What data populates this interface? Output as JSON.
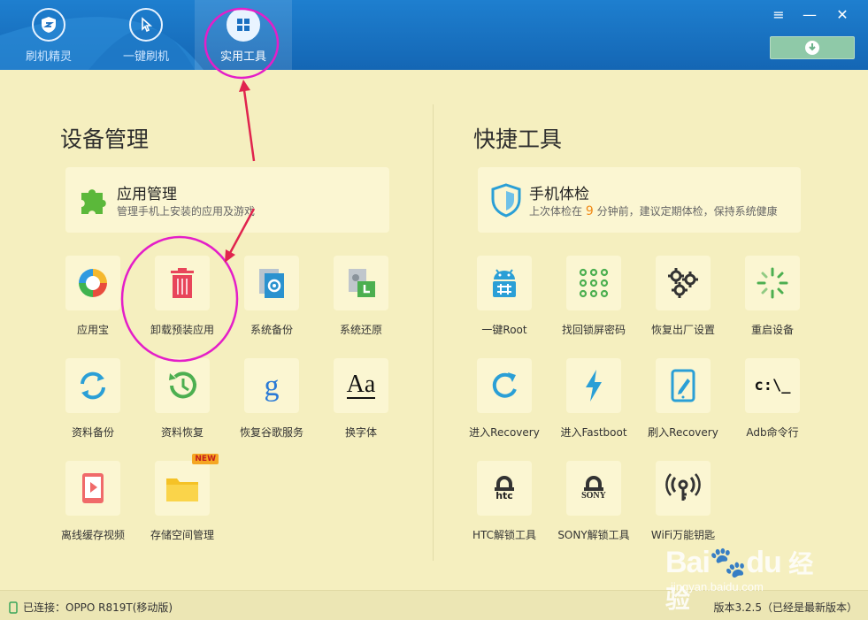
{
  "nav": {
    "tabs": [
      {
        "label": "刷机精灵",
        "icon": "shield-icon"
      },
      {
        "label": "一键刷机",
        "icon": "cursor-icon"
      },
      {
        "label": "实用工具",
        "icon": "grid-icon"
      }
    ],
    "active": 2
  },
  "window": {
    "menu": "≡",
    "minimize": "—",
    "close": "✕"
  },
  "device_mgmt": {
    "title": "设备管理",
    "card": {
      "title": "应用管理",
      "subtitle": "管理手机上安装的应用及游戏",
      "icon": "puzzle-icon"
    },
    "tools": [
      {
        "label": "应用宝",
        "icon": "app-store-icon"
      },
      {
        "label": "卸载预装应用",
        "icon": "trash-icon"
      },
      {
        "label": "系统备份",
        "icon": "system-backup-icon"
      },
      {
        "label": "系统还原",
        "icon": "system-restore-icon"
      },
      {
        "label": "资料备份",
        "icon": "sync-icon"
      },
      {
        "label": "资料恢复",
        "icon": "history-icon"
      },
      {
        "label": "恢复谷歌服务",
        "icon": "google-icon"
      },
      {
        "label": "换字体",
        "icon": "font-icon",
        "glyph": "Aa"
      },
      {
        "label": "离线缓存视频",
        "icon": "video-icon"
      },
      {
        "label": "存储空间管理",
        "icon": "folder-icon",
        "badge": "NEW"
      }
    ]
  },
  "quick_tools": {
    "title": "快捷工具",
    "card": {
      "title": "手机体检",
      "sub_prefix": "上次体检在",
      "sub_num": "9",
      "sub_suffix": "分钟前，建议定期体检，保持系统健康",
      "icon": "shield-check-icon"
    },
    "tools": [
      {
        "label": "一键Root",
        "icon": "android-icon"
      },
      {
        "label": "找回锁屏密码",
        "icon": "pattern-lock-icon"
      },
      {
        "label": "恢复出厂设置",
        "icon": "gears-icon"
      },
      {
        "label": "重启设备",
        "icon": "loading-icon"
      },
      {
        "label": "进入Recovery",
        "icon": "refresh-icon"
      },
      {
        "label": "进入Fastboot",
        "icon": "lightning-icon"
      },
      {
        "label": "刷入Recovery",
        "icon": "tablet-edit-icon"
      },
      {
        "label": "Adb命令行",
        "icon": "terminal-icon",
        "glyph": "c:\\_"
      },
      {
        "label": "HTC解锁工具",
        "icon": "htc-lock-icon",
        "glyph": "htc"
      },
      {
        "label": "SONY解锁工具",
        "icon": "sony-lock-icon",
        "glyph": "SONY"
      },
      {
        "label": "WiFi万能钥匙",
        "icon": "wifi-key-icon"
      }
    ]
  },
  "status": {
    "connected": "已连接：OPPO R819T(移动版)",
    "version": "版本3.2.5（已经是最新版本）"
  },
  "watermark": {
    "brand": "Bai",
    "brand2": "du",
    "cn": "经验",
    "url": "jingyan.baidu.com"
  }
}
